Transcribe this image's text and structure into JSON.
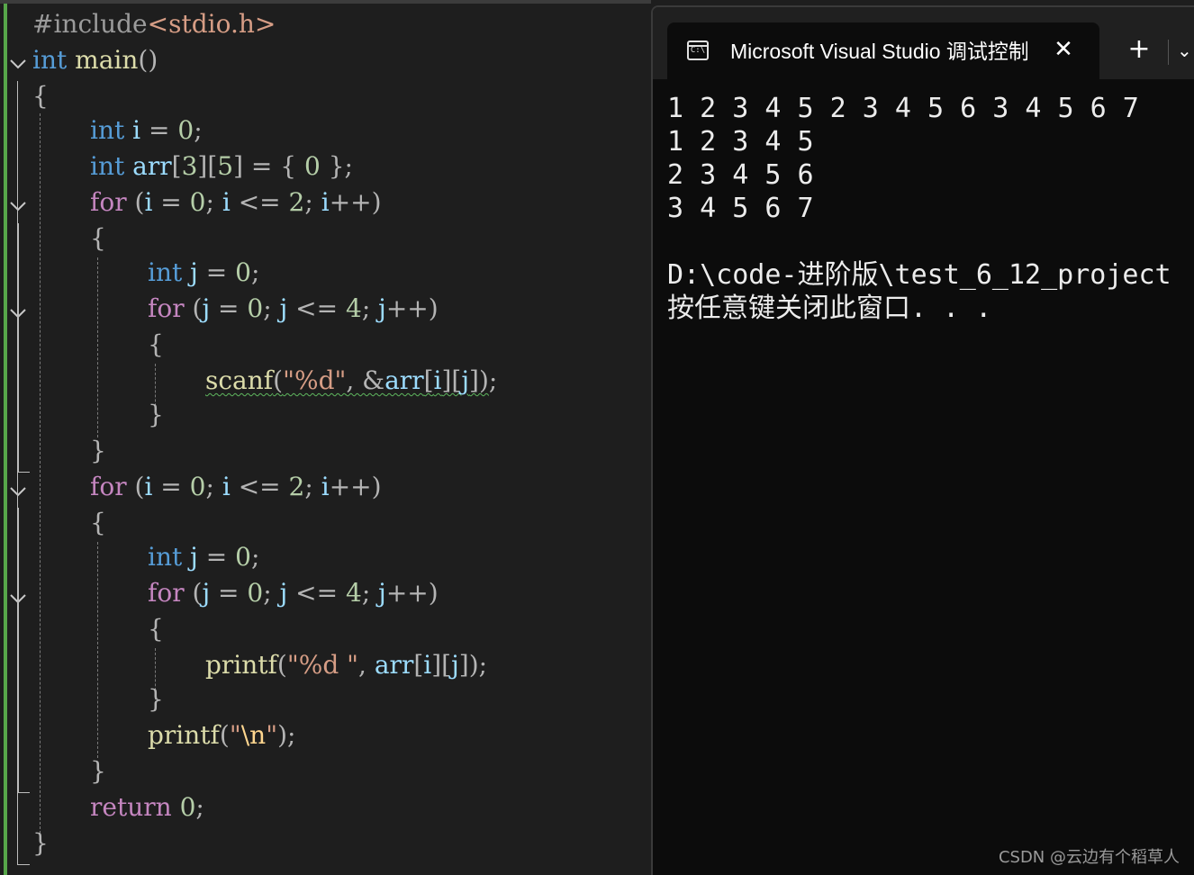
{
  "editor": {
    "lines": [
      [
        {
          "t": "#include",
          "c": "pre"
        },
        {
          "t": "<stdio.h>",
          "c": "inc"
        }
      ],
      [
        {
          "t": "int",
          "c": "kw"
        },
        {
          "t": " main",
          "c": "fn"
        },
        {
          "t": "()",
          "c": "punct"
        }
      ],
      [
        {
          "t": "{",
          "c": "punct"
        }
      ],
      [
        {
          "t": "int",
          "c": "kw"
        },
        {
          "t": " i",
          "c": "id"
        },
        {
          "t": " = ",
          "c": "punct"
        },
        {
          "t": "0",
          "c": "num"
        },
        {
          "t": ";",
          "c": "punct"
        }
      ],
      [
        {
          "t": "int",
          "c": "kw"
        },
        {
          "t": " arr",
          "c": "id"
        },
        {
          "t": "[",
          "c": "punct"
        },
        {
          "t": "3",
          "c": "num"
        },
        {
          "t": "][",
          "c": "punct"
        },
        {
          "t": "5",
          "c": "num"
        },
        {
          "t": "] = { ",
          "c": "punct"
        },
        {
          "t": "0",
          "c": "num"
        },
        {
          "t": " };",
          "c": "punct"
        }
      ],
      [
        {
          "t": "for",
          "c": "kw2"
        },
        {
          "t": " (",
          "c": "punct"
        },
        {
          "t": "i",
          "c": "id"
        },
        {
          "t": " = ",
          "c": "punct"
        },
        {
          "t": "0",
          "c": "num"
        },
        {
          "t": "; ",
          "c": "punct"
        },
        {
          "t": "i",
          "c": "id"
        },
        {
          "t": " <= ",
          "c": "punct"
        },
        {
          "t": "2",
          "c": "num"
        },
        {
          "t": "; ",
          "c": "punct"
        },
        {
          "t": "i",
          "c": "id"
        },
        {
          "t": "++)",
          "c": "punct"
        }
      ],
      [
        {
          "t": "{",
          "c": "punct"
        }
      ],
      [
        {
          "t": "int",
          "c": "kw"
        },
        {
          "t": " j",
          "c": "id"
        },
        {
          "t": " = ",
          "c": "punct"
        },
        {
          "t": "0",
          "c": "num"
        },
        {
          "t": ";",
          "c": "punct"
        }
      ],
      [
        {
          "t": "for",
          "c": "kw2"
        },
        {
          "t": " (",
          "c": "punct"
        },
        {
          "t": "j",
          "c": "id"
        },
        {
          "t": " = ",
          "c": "punct"
        },
        {
          "t": "0",
          "c": "num"
        },
        {
          "t": "; ",
          "c": "punct"
        },
        {
          "t": "j",
          "c": "id"
        },
        {
          "t": " <= ",
          "c": "punct"
        },
        {
          "t": "4",
          "c": "num"
        },
        {
          "t": "; ",
          "c": "punct"
        },
        {
          "t": "j",
          "c": "id"
        },
        {
          "t": "++)",
          "c": "punct"
        }
      ],
      [
        {
          "t": "{",
          "c": "punct"
        }
      ],
      [
        {
          "t": "scanf",
          "c": "fn squiggle"
        },
        {
          "t": "(",
          "c": "punct squiggle"
        },
        {
          "t": "\"%d\"",
          "c": "str squiggle"
        },
        {
          "t": ", &",
          "c": "punct squiggle"
        },
        {
          "t": "arr",
          "c": "id squiggle"
        },
        {
          "t": "[",
          "c": "punct squiggle"
        },
        {
          "t": "i",
          "c": "id squiggle"
        },
        {
          "t": "][",
          "c": "punct squiggle"
        },
        {
          "t": "j",
          "c": "id squiggle"
        },
        {
          "t": "])",
          "c": "punct squiggle"
        },
        {
          "t": ";",
          "c": "punct"
        }
      ],
      [
        {
          "t": "}",
          "c": "punct"
        }
      ],
      [
        {
          "t": "}",
          "c": "punct"
        }
      ],
      [
        {
          "t": "for",
          "c": "kw2"
        },
        {
          "t": " (",
          "c": "punct"
        },
        {
          "t": "i",
          "c": "id"
        },
        {
          "t": " = ",
          "c": "punct"
        },
        {
          "t": "0",
          "c": "num"
        },
        {
          "t": "; ",
          "c": "punct"
        },
        {
          "t": "i",
          "c": "id"
        },
        {
          "t": " <= ",
          "c": "punct"
        },
        {
          "t": "2",
          "c": "num"
        },
        {
          "t": "; ",
          "c": "punct"
        },
        {
          "t": "i",
          "c": "id"
        },
        {
          "t": "++)",
          "c": "punct"
        }
      ],
      [
        {
          "t": "{",
          "c": "punct"
        }
      ],
      [
        {
          "t": "int",
          "c": "kw"
        },
        {
          "t": " j",
          "c": "id"
        },
        {
          "t": " = ",
          "c": "punct"
        },
        {
          "t": "0",
          "c": "num"
        },
        {
          "t": ";",
          "c": "punct"
        }
      ],
      [
        {
          "t": "for",
          "c": "kw2"
        },
        {
          "t": " (",
          "c": "punct"
        },
        {
          "t": "j",
          "c": "id"
        },
        {
          "t": " = ",
          "c": "punct"
        },
        {
          "t": "0",
          "c": "num"
        },
        {
          "t": "; ",
          "c": "punct"
        },
        {
          "t": "j",
          "c": "id"
        },
        {
          "t": " <= ",
          "c": "punct"
        },
        {
          "t": "4",
          "c": "num"
        },
        {
          "t": "; ",
          "c": "punct"
        },
        {
          "t": "j",
          "c": "id"
        },
        {
          "t": "++)",
          "c": "punct"
        }
      ],
      [
        {
          "t": "{",
          "c": "punct"
        }
      ],
      [
        {
          "t": "printf",
          "c": "fn"
        },
        {
          "t": "(",
          "c": "punct"
        },
        {
          "t": "\"%d \"",
          "c": "str"
        },
        {
          "t": ", ",
          "c": "punct"
        },
        {
          "t": "arr",
          "c": "id"
        },
        {
          "t": "[",
          "c": "punct"
        },
        {
          "t": "i",
          "c": "id"
        },
        {
          "t": "][",
          "c": "punct"
        },
        {
          "t": "j",
          "c": "id"
        },
        {
          "t": "]);",
          "c": "punct"
        }
      ],
      [
        {
          "t": "}",
          "c": "punct"
        }
      ],
      [
        {
          "t": "printf",
          "c": "fn"
        },
        {
          "t": "(",
          "c": "punct"
        },
        {
          "t": "\"",
          "c": "str"
        },
        {
          "t": "\\n",
          "c": "esc"
        },
        {
          "t": "\"",
          "c": "str"
        },
        {
          "t": ");",
          "c": "punct"
        }
      ],
      [
        {
          "t": "}",
          "c": "punct"
        }
      ],
      [
        {
          "t": "return",
          "c": "kw2"
        },
        {
          "t": " ",
          "c": "punct"
        },
        {
          "t": "0",
          "c": "num"
        },
        {
          "t": ";",
          "c": "punct"
        }
      ],
      [
        {
          "t": "}",
          "c": "punct"
        }
      ]
    ]
  },
  "console": {
    "tab_title": "Microsoft Visual Studio 调试控制台",
    "tab_icon_label": "C:\\",
    "close_glyph": "✕",
    "new_tab_glyph": "+",
    "dropdown_glyph": "⌄",
    "output_lines": [
      "1 2 3 4 5 2 3 4 5 6 3 4 5 6 7",
      "1 2 3 4 5",
      "2 3 4 5 6",
      "3 4 5 6 7",
      "",
      "D:\\code-进阶版\\test_6_12_project",
      "按任意键关闭此窗口. . ."
    ]
  },
  "watermark": "CSDN @云边有个稻草人"
}
